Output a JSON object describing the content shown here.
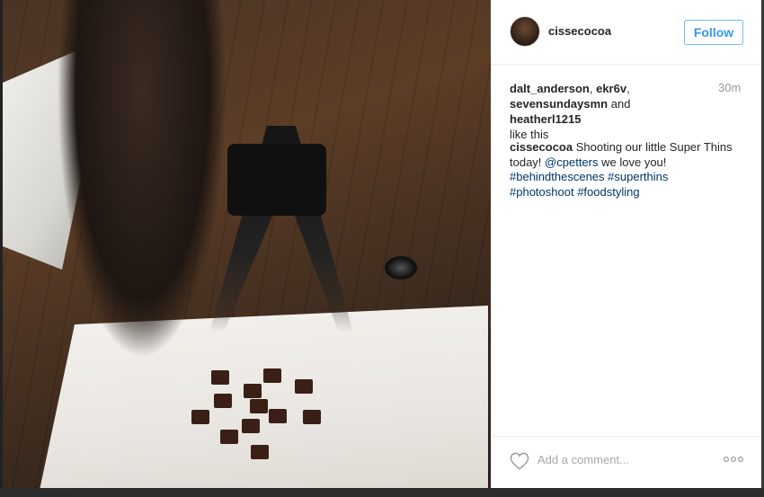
{
  "post": {
    "username": "cissecocoa",
    "follow_label": "Follow",
    "likes": {
      "names": [
        "dalt_anderson",
        "ekr6v",
        "sevensundaysmn"
      ],
      "and_text": "and",
      "last_name": "heatherl1215",
      "suffix": "like this"
    },
    "time": "30m",
    "caption": {
      "user": "cissecocoa",
      "text1": "Shooting our little Super Thins today!",
      "mention": "@cpetters",
      "text2": "we love you!",
      "tags": [
        "#behindthescenes",
        "#superthins",
        "#photoshoot",
        "#foodstyling"
      ]
    },
    "comment_placeholder": "Add a comment...",
    "icons": {
      "like": "heart-icon",
      "more": "more-options-icon"
    },
    "colors": {
      "follow": "#3897f0",
      "link": "#003569",
      "muted": "#999999"
    }
  }
}
